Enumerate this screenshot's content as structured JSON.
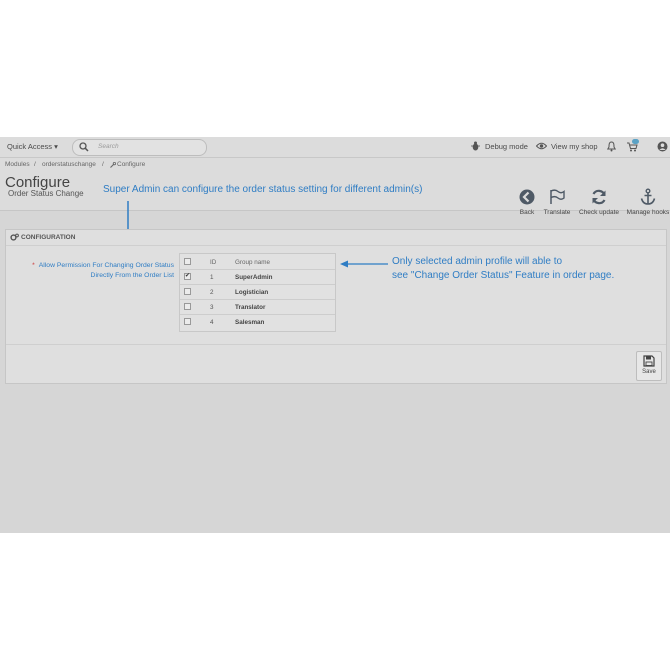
{
  "topbar": {
    "quick_access": "Quick Access",
    "search_placeholder": "Search",
    "debug_mode": "Debug mode",
    "view_shop": "View my shop"
  },
  "breadcrumb": {
    "items": [
      "Modules",
      "orderstatuschange",
      "Configure"
    ],
    "separator": "/"
  },
  "page": {
    "title": "Configure",
    "subtitle": "Order Status Change"
  },
  "toolbar": {
    "back": "Back",
    "translate": "Translate",
    "check_update": "Check update",
    "manage_hooks": "Manage hooks"
  },
  "annotations": {
    "top": "Super Admin can configure the order status setting for different admin(s)",
    "right_line1": "Only selected admin profile will able to",
    "right_line2": "see \"Change Order Status\" Feature in order page."
  },
  "panel": {
    "heading": "CONFIGURATION",
    "field_label_line1": "Allow Permission For Changing Order Status",
    "field_label_line2": "Directly From the Order List",
    "required_mark": "*"
  },
  "groups_table": {
    "headers": [
      "ID",
      "Group name"
    ],
    "rows": [
      {
        "id": "1",
        "name": "SuperAdmin",
        "checked": true
      },
      {
        "id": "2",
        "name": "Logistician",
        "checked": false
      },
      {
        "id": "3",
        "name": "Translator",
        "checked": false
      },
      {
        "id": "4",
        "name": "Salesman",
        "checked": false
      }
    ]
  },
  "footer": {
    "save": "Save"
  },
  "colors": {
    "annotation_blue": "#2f7dc4",
    "overlay_gray": "#d6d6d6"
  },
  "icons": [
    "search-icon",
    "bug-icon",
    "eye-icon",
    "bell-icon",
    "cart-icon",
    "user-icon",
    "back-icon",
    "flag-icon",
    "refresh-icon",
    "anchor-icon",
    "gears-icon",
    "save-icon",
    "wrench-icon"
  ]
}
